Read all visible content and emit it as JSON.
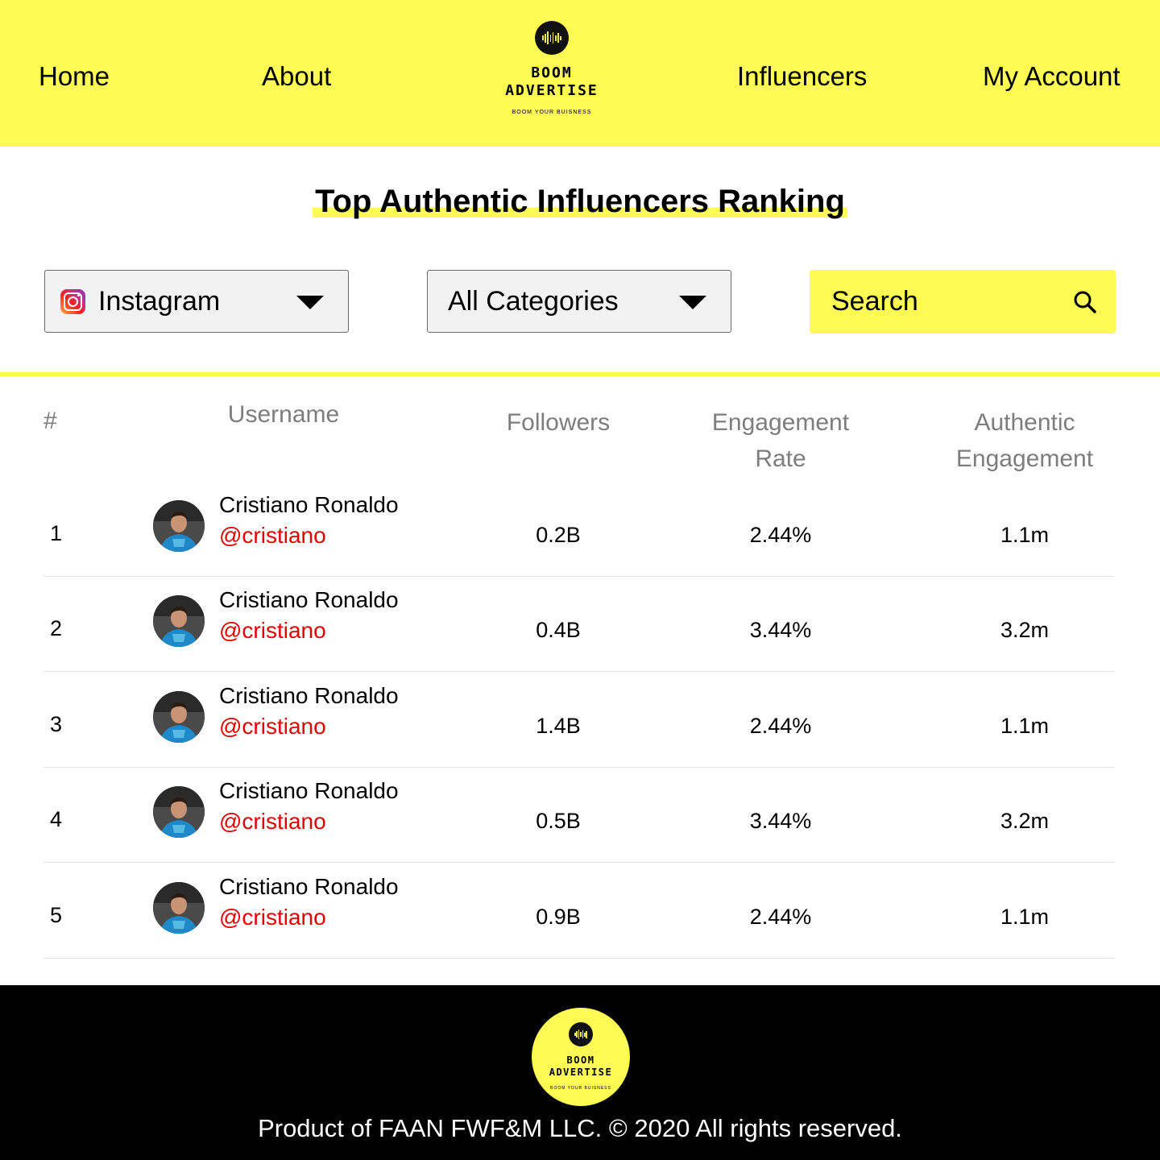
{
  "header": {
    "nav": [
      "Home",
      "About",
      "Influencers",
      "My Account"
    ],
    "logo": {
      "line1": "BOOM",
      "line2": "ADVERTISE",
      "tagline": "BOOM YOUR BUISNESS"
    }
  },
  "title": "Top Authentic Influencers Ranking",
  "filters": {
    "platform": "Instagram",
    "category": "All Categories",
    "search_placeholder": "Search",
    "platform_icon": "instagram-icon",
    "search_icon": "search-icon",
    "dropdown_icon": "chevron-down-icon"
  },
  "table": {
    "headers": {
      "rank": "#",
      "username": "Username",
      "followers": "Followers",
      "engagement_rate": [
        "Engagement",
        "Rate"
      ],
      "authentic_engagement": [
        "Authentic",
        "Engagement"
      ]
    },
    "rows": [
      {
        "rank": "1",
        "name": "Cristiano Ronaldo",
        "handle": "@cristiano",
        "followers": "0.2B",
        "engagement_rate": "2.44%",
        "authentic_engagement": "1.1m"
      },
      {
        "rank": "2",
        "name": "Cristiano Ronaldo",
        "handle": "@cristiano",
        "followers": "0.4B",
        "engagement_rate": "3.44%",
        "authentic_engagement": "3.2m"
      },
      {
        "rank": "3",
        "name": "Cristiano Ronaldo",
        "handle": "@cristiano",
        "followers": "1.4B",
        "engagement_rate": "2.44%",
        "authentic_engagement": "1.1m"
      },
      {
        "rank": "4",
        "name": "Cristiano Ronaldo",
        "handle": "@cristiano",
        "followers": "0.5B",
        "engagement_rate": "3.44%",
        "authentic_engagement": "3.2m"
      },
      {
        "rank": "5",
        "name": "Cristiano Ronaldo",
        "handle": "@cristiano",
        "followers": "0.9B",
        "engagement_rate": "2.44%",
        "authentic_engagement": "1.1m"
      }
    ]
  },
  "footer": {
    "logo": {
      "line1": "BOOM",
      "line2": "ADVERTISE",
      "tagline": "BOOM YOUR BUISNESS"
    },
    "copyright": "Product of FAAN FWF&M LLC.  © 2020 All rights reserved."
  },
  "colors": {
    "accent": "#fefb54",
    "handle": "#e30000",
    "header_text": "#7d7d7d",
    "footer_bg": "#000000"
  }
}
